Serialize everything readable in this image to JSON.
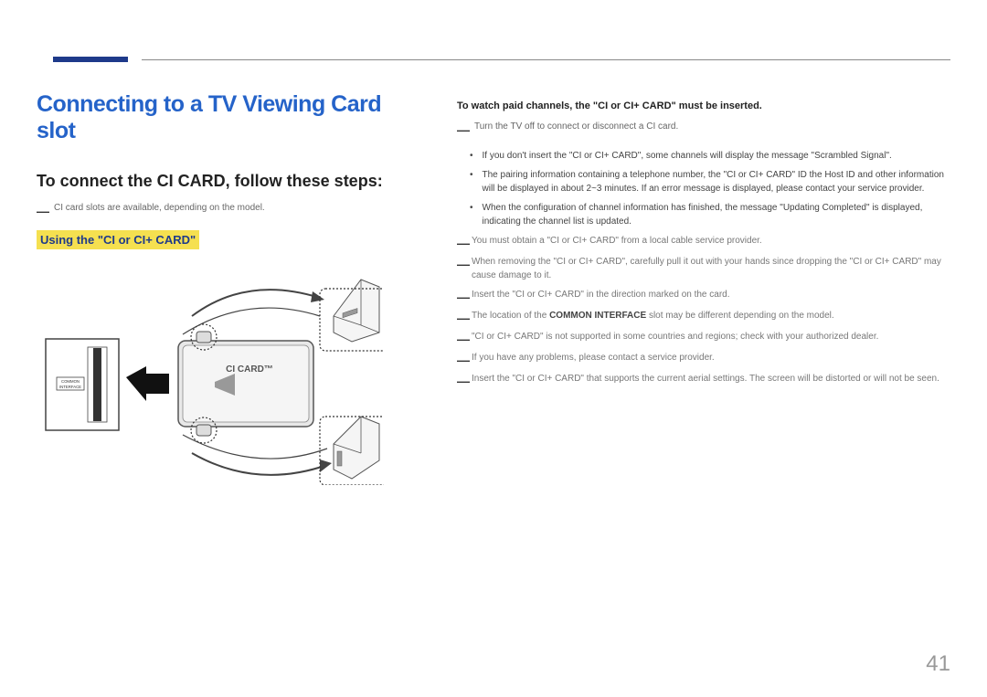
{
  "page_number": "41",
  "main_title": "Connecting to a TV Viewing Card slot",
  "sub_title": "To connect the CI CARD, follow these steps:",
  "left_note_dash": "―",
  "left_note": "CI card slots are available, depending on the model.",
  "highlight_heading": "Using the \"CI or CI+ CARD\"",
  "diagram": {
    "slot_label": "COMMON INTERFACE",
    "card_label": "CI CARD™"
  },
  "right_heading": "To watch paid channels, the \"CI or CI+ CARD\" must be inserted.",
  "right_top_dash": "―",
  "right_top_note": "Turn the TV off to connect or disconnect a CI card.",
  "bullets": [
    "If you don't insert the \"CI or CI+ CARD\", some channels will display the message \"Scrambled Signal\".",
    "The pairing information containing a telephone number, the \"CI or CI+ CARD\" ID the Host ID and other information will be displayed in about 2~3 minutes. If an error message is displayed, please contact your service provider.",
    "When the configuration of channel information has finished, the message \"Updating Completed\" is displayed, indicating the channel list is updated."
  ],
  "sub_notes": [
    {
      "text": "You must obtain a \"CI or CI+ CARD\" from a local cable service provider."
    },
    {
      "text": "When removing the \"CI or CI+ CARD\", carefully pull it out with your hands since dropping the \"CI or CI+ CARD\" may cause damage to it."
    },
    {
      "text": "Insert the \"CI or CI+ CARD\" in the direction marked on the card."
    },
    {
      "prefix": "The location of the ",
      "bold": "COMMON INTERFACE",
      "suffix": " slot may be different depending on the model."
    },
    {
      "text": "\"CI or CI+ CARD\" is not supported in some countries and regions; check with your authorized dealer."
    },
    {
      "text": "If you have any problems, please contact a service provider."
    },
    {
      "text": "Insert the \"CI or CI+ CARD\" that supports the current aerial settings. The screen will be distorted or will not be seen."
    }
  ]
}
